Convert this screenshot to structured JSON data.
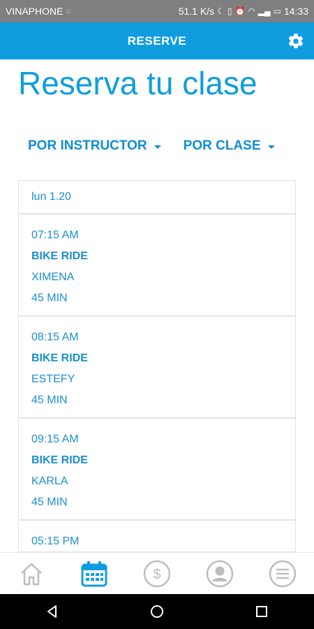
{
  "status_bar": {
    "carrier": "VINAPHONE",
    "speed": "51.1 K/s",
    "time": "14:33"
  },
  "app_bar": {
    "title": "RESERVE",
    "settings_icon": "gear-icon"
  },
  "page": {
    "title": "Reserva tu clase"
  },
  "filters": [
    {
      "label": "POR INSTRUCTOR"
    },
    {
      "label": "POR CLASE"
    }
  ],
  "schedule": {
    "date": "lun 1.20",
    "classes": [
      {
        "time": "07:15 AM",
        "name": "BIKE RIDE",
        "instructor": "XIMENA",
        "duration": "45 MIN"
      },
      {
        "time": "08:15 AM",
        "name": "BIKE RIDE",
        "instructor": "ESTEFY",
        "duration": "45 MIN"
      },
      {
        "time": "09:15 AM",
        "name": "BIKE RIDE",
        "instructor": "KARLA",
        "duration": "45 MIN"
      },
      {
        "time": "05:15 PM",
        "name": "",
        "instructor": "",
        "duration": ""
      }
    ]
  },
  "bottom_nav": [
    {
      "icon": "home-icon",
      "active": false
    },
    {
      "icon": "calendar-icon",
      "active": true
    },
    {
      "icon": "dollar-icon",
      "active": false
    },
    {
      "icon": "profile-icon",
      "active": false
    },
    {
      "icon": "menu-icon",
      "active": false
    }
  ],
  "colors": {
    "accent": "#0f9de0",
    "text_blue": "#1b8fd2",
    "inactive_icon": "#bdbdbd"
  }
}
